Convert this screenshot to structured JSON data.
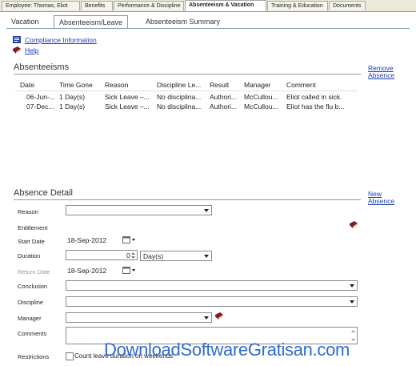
{
  "top_tabs": [
    {
      "label": "Employee: Thomas, Eliot"
    },
    {
      "label": "Benefits"
    },
    {
      "label": "Performance & Discipline"
    },
    {
      "label": "Absenteeism & Vacation"
    },
    {
      "label": "Training & Education"
    },
    {
      "label": "Documents"
    }
  ],
  "sub_tabs": [
    {
      "label": "Vacation"
    },
    {
      "label": "Absenteeism/Leave"
    },
    {
      "label": "Absenteeism Summary"
    }
  ],
  "links": {
    "compliance": "Compliance Information",
    "help": "Help"
  },
  "absenteeisms": {
    "title": "Absenteeisms",
    "remove_link": "Remove Absence",
    "columns": [
      "Date",
      "Time Gone",
      "Reason",
      "Discipline Le...",
      "Result",
      "Manager",
      "Comment"
    ],
    "rows": [
      [
        "06-Jun-...",
        "1 Day(s)",
        "Sick Leave –...",
        "No disciplina...",
        "Authori...",
        "McCullou...",
        "Eliot called in sick."
      ],
      [
        "07-Dec...",
        "1 Day(s)",
        "Sick Leave –...",
        "No disciplina...",
        "Authori...",
        "McCullou...",
        "Eliot has the flu b..."
      ]
    ]
  },
  "detail": {
    "title": "Absence Detail",
    "new_link": "New Absence",
    "labels": {
      "reason": "Reason",
      "entitlement": "Entitlement",
      "start_date": "Start Date",
      "duration": "Duration",
      "return_date": "Return Date",
      "conclusion": "Conclusion",
      "discipline": "Discipline",
      "manager": "Manager",
      "comments": "Comments",
      "restrictions": "Restrictions"
    },
    "values": {
      "start_date": "18-Sep-2012",
      "duration": "0",
      "duration_unit": "Day(s)",
      "return_date": "18-Sep-2012",
      "restriction_text": "Count leave duration on weekends"
    }
  },
  "watermark": {
    "part1": "DownloadSoftware",
    "part2": "Gratisan",
    "part3": ".com"
  },
  "colors": {
    "link": "#1a3fb8",
    "book_icon": "#8b1a1a",
    "watermark": "#2f6bd1"
  }
}
